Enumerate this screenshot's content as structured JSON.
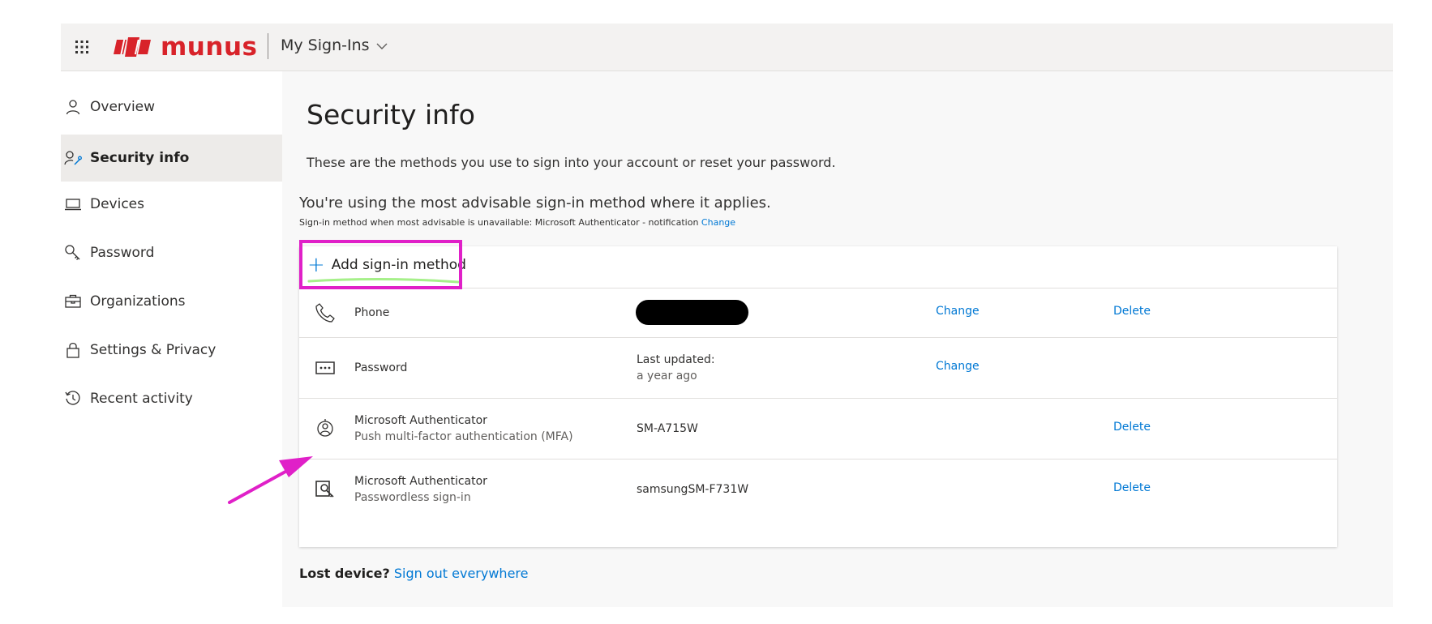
{
  "colors": {
    "accent": "#0078d4",
    "brand": "#d8232a",
    "annotation": "#e020c8"
  },
  "header": {
    "brand_name": "munus",
    "app_title": "My Sign-Ins",
    "waffle_icon": "waffle-icon",
    "chevron_icon": "chevron-down-icon"
  },
  "sidebar": {
    "items": [
      {
        "label": "Overview",
        "icon": "person-icon",
        "active": false
      },
      {
        "label": "Security info",
        "icon": "security-person-key-icon",
        "active": true
      },
      {
        "label": "Devices",
        "icon": "laptop-icon",
        "active": false
      },
      {
        "label": "Password",
        "icon": "key-icon",
        "active": false
      },
      {
        "label": "Organizations",
        "icon": "briefcase-icon",
        "active": false
      },
      {
        "label": "Settings & Privacy",
        "icon": "lock-icon",
        "active": false
      },
      {
        "label": "Recent activity",
        "icon": "history-icon",
        "active": false
      }
    ]
  },
  "main": {
    "title": "Security info",
    "subtitle": "These are the methods you use to sign into your account or reset your password.",
    "advisable": "You're using the most advisable sign-in method where it applies.",
    "default_method_text": "Sign-in method when most advisable is unavailable: Microsoft Authenticator - notification",
    "default_method_change": "Change",
    "add_method_label": "Add sign-in method",
    "methods": [
      {
        "icon": "phone-icon",
        "name": "Phone",
        "name_sub": "",
        "detail": "",
        "detail_sub": "",
        "redacted": true,
        "action1": "Change",
        "action2": "Delete"
      },
      {
        "icon": "password-dots-icon",
        "name": "Password",
        "name_sub": "",
        "detail": "Last updated:",
        "detail_sub": "a year ago",
        "redacted": false,
        "action1": "Change",
        "action2": ""
      },
      {
        "icon": "authenticator-icon",
        "name": "Microsoft Authenticator",
        "name_sub": "Push multi-factor authentication (MFA)",
        "detail": "SM-A715W",
        "detail_sub": "",
        "redacted": false,
        "action1": "",
        "action2": "Delete"
      },
      {
        "icon": "passwordless-icon",
        "name": "Microsoft Authenticator",
        "name_sub": "Passwordless sign-in",
        "detail": "samsungSM-F731W",
        "detail_sub": "",
        "redacted": false,
        "action1": "",
        "action2": "Delete"
      }
    ],
    "lost_device_label": "Lost device?",
    "lost_device_link": "Sign out everywhere"
  }
}
